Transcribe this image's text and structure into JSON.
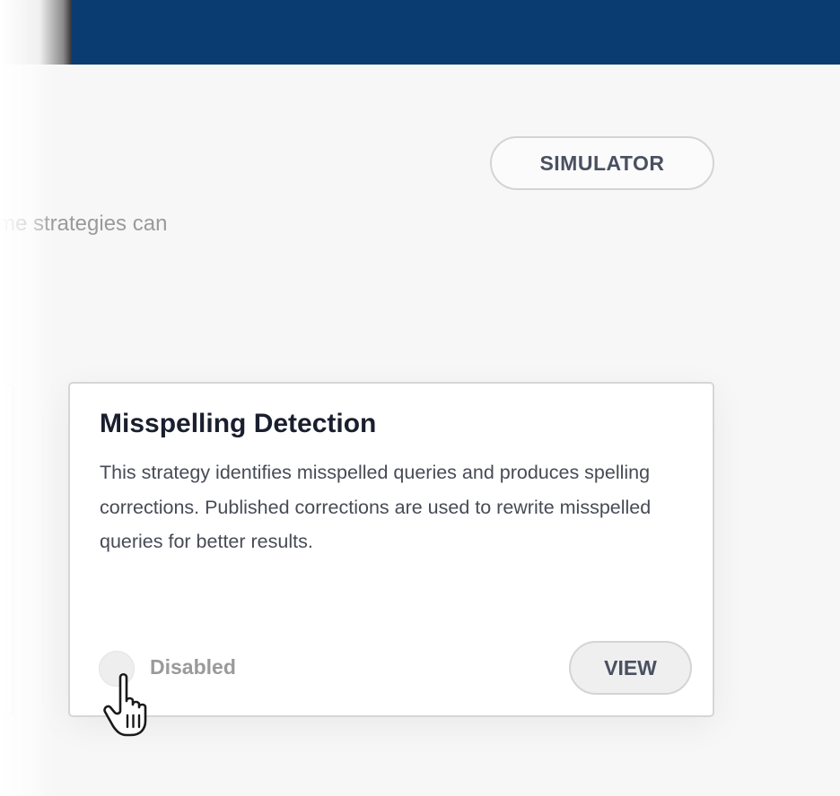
{
  "header": {
    "color": "#0b3c71"
  },
  "toolbar": {
    "simulator_label": "SIMULATOR"
  },
  "intro": {
    "text": "me strategies can"
  },
  "card": {
    "title": "Misspelling Detection",
    "description": "This strategy identifies misspelled queries and produces spelling corrections. Published corrections are used to rewrite misspelled queries for better results.",
    "status_label": "Disabled",
    "view_label": "VIEW",
    "enabled": false
  },
  "cursor": {
    "icon": "hand-pointer-icon"
  }
}
